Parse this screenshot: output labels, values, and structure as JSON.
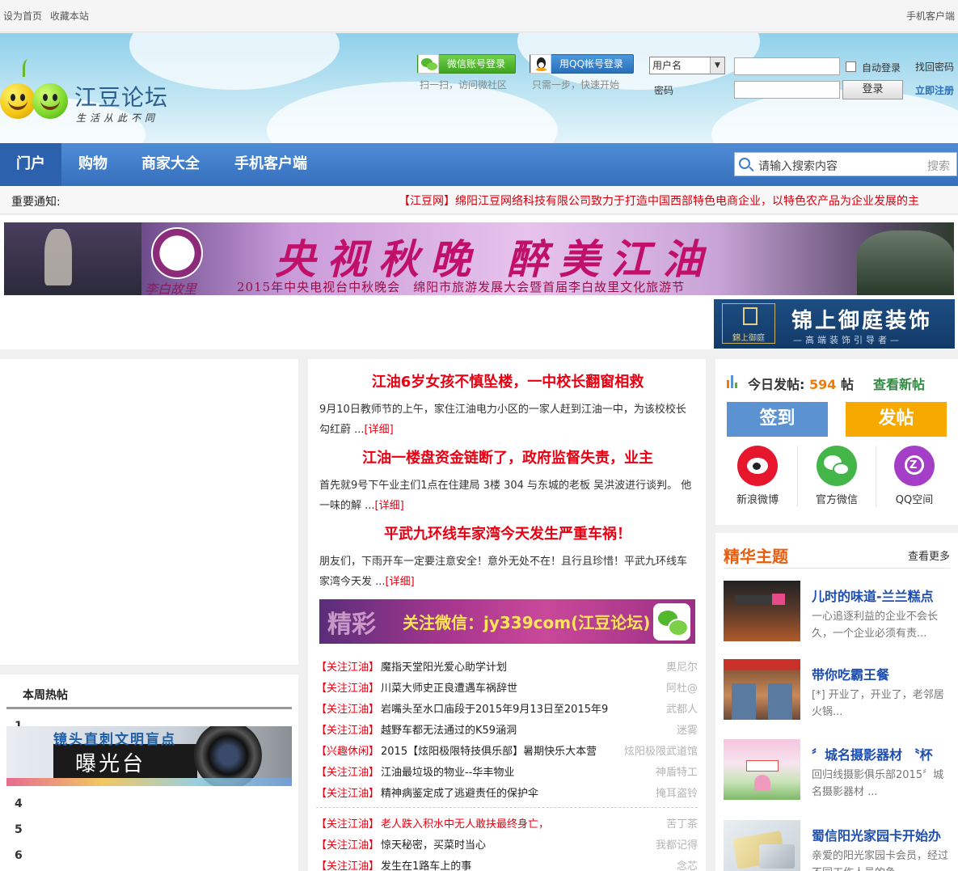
{
  "topbar": {
    "set_home": "设为首页",
    "bookmark": "收藏本站",
    "mobile": "手机客户端"
  },
  "logo": {
    "name": "江豆论坛",
    "slogan": "生活从此不同"
  },
  "social": {
    "wechat_btn": "微信账号登录",
    "wechat_sub": "扫一扫，访问微社区",
    "qq_btn": "用QQ帐号登录",
    "qq_sub": "只需一步，快速开始"
  },
  "login": {
    "select_value": "用户名",
    "password_label": "密码",
    "auto_login": "自动登录",
    "find_password": "找回密码",
    "login_btn": "登录",
    "register": "立即注册"
  },
  "nav": {
    "items": [
      "门户",
      "购物",
      "商家大全",
      "手机客户端"
    ],
    "active": "门户"
  },
  "search": {
    "placeholder": "请输入搜索内容",
    "button": "搜索"
  },
  "notice": {
    "label": "重要通知:",
    "text": "【江豆网】绵阳江豆网络科技有限公司致力于打造中国西部特色电商企业，以特色农产品为企业发展的主"
  },
  "banner1": {
    "title": "央视秋晚 醉美江油",
    "subtitle": "2015年中央电视台中秋晚会　绵阳市旅游发展大会暨首届李白故里文化旅游节",
    "caption": "李白故里"
  },
  "banner2": {
    "title": "锦上御庭装饰",
    "subtitle": "—高端装饰引导者—",
    "logo_text": "錦上御庭"
  },
  "hot": {
    "title": "本周热帖",
    "numbers": [
      "1",
      "4",
      "5",
      "6"
    ]
  },
  "expose": {
    "line1": "镜头直刺文明盲点",
    "line2": "曝光台"
  },
  "stories": [
    {
      "headline": "江油6岁女孩不慎坠楼，一中校长翻窗相救",
      "summary": "9月10日教师节的上午，家住江油电力小区的一家人赶到江油一中，为该校校长勾红蔚 ...",
      "more": "[详细]"
    },
    {
      "headline": "江油一楼盘资金链断了，政府监督失责，业主",
      "summary": "首先就9号下午业主们1点在住建局 3楼 304 与东城的老板 吴洪波进行谈判。 他一味的解 ...",
      "more": "[详细]"
    },
    {
      "headline": "平武九环线车家湾今天发生严重车祸！",
      "summary": "朋友们，下雨开车一定要注意安全！意外无处不在！且行且珍惜！平武九环线车家湾今天发 ...",
      "more": "[详细]"
    }
  ],
  "wxbanner": {
    "jing": "精彩",
    "text": "关注微信：jy339com(江豆论坛)"
  },
  "threads1": [
    {
      "cat": "【关注江油】",
      "title": "魔指天堂阳光爱心助学计划",
      "author": "奥尼尔"
    },
    {
      "cat": "【关注江油】",
      "title": "川菜大师史正良遭遇车祸辞世",
      "author": "阿杜@"
    },
    {
      "cat": "【关注江油】",
      "title": "岩嘴头至水口庙段于2015年9月13日至2015年9",
      "author": "武都人"
    },
    {
      "cat": "【关注江油】",
      "title": "越野车都无法通过的K59涵洞",
      "author": "迷雾"
    },
    {
      "cat": "【兴趣休闲】",
      "title": "2015【炫阳极限特技俱乐部】暑期快乐大本营",
      "author": "炫阳极限武道馆"
    },
    {
      "cat": "【关注江油】",
      "title": "江油最垃圾的物业--华丰物业",
      "author": "神盾特工"
    },
    {
      "cat": "【关注江油】",
      "title": "精神病鉴定成了逃避责任的保护伞",
      "author": "掩耳盗铃"
    }
  ],
  "threads2": [
    {
      "cat": "【关注江油】",
      "title": "老人跌入积水中无人敢扶最终身亡，",
      "author": "苦丁茶",
      "red": true
    },
    {
      "cat": "【关注江油】",
      "title": "惊天秘密，买菜时当心",
      "author": "我都记得",
      "red": false
    },
    {
      "cat": "【关注江油】",
      "title": "发生在1路车上的事",
      "author": "念芯",
      "red": false
    }
  ],
  "postbox": {
    "today_label": "今日发帖:",
    "today_count": "594",
    "today_unit": "帖",
    "view_new": "查看新帖",
    "sign": "签到",
    "post": "发帖",
    "weibo": "新浪微博",
    "wechat": "官方微信",
    "qzone": "QQ空间"
  },
  "featured": {
    "title": "精华主题",
    "more": "查看更多",
    "items": [
      {
        "title": "儿时的味道-兰兰糕点",
        "desc": "一心追逐利益的企业不会长久，一个企业必须有责..."
      },
      {
        "title": "带你吃霸王餐",
        "desc": "[*] 开业了，开业了，老邻居火锅..."
      },
      {
        "title": "〞城名摄影器材 〝杯",
        "desc": "回归线摄影俱乐部2015〞城名摄影器材 ..."
      },
      {
        "title": "蜀信阳光家园卡开始办",
        "desc": "亲爱的阳光家园卡会员，经过不同工作人员的争"
      }
    ]
  },
  "colors": {
    "nav": "#3f7dcb",
    "accent_red": "#e60012",
    "orange": "#f8a900",
    "sign_blue": "#5b92d1"
  }
}
